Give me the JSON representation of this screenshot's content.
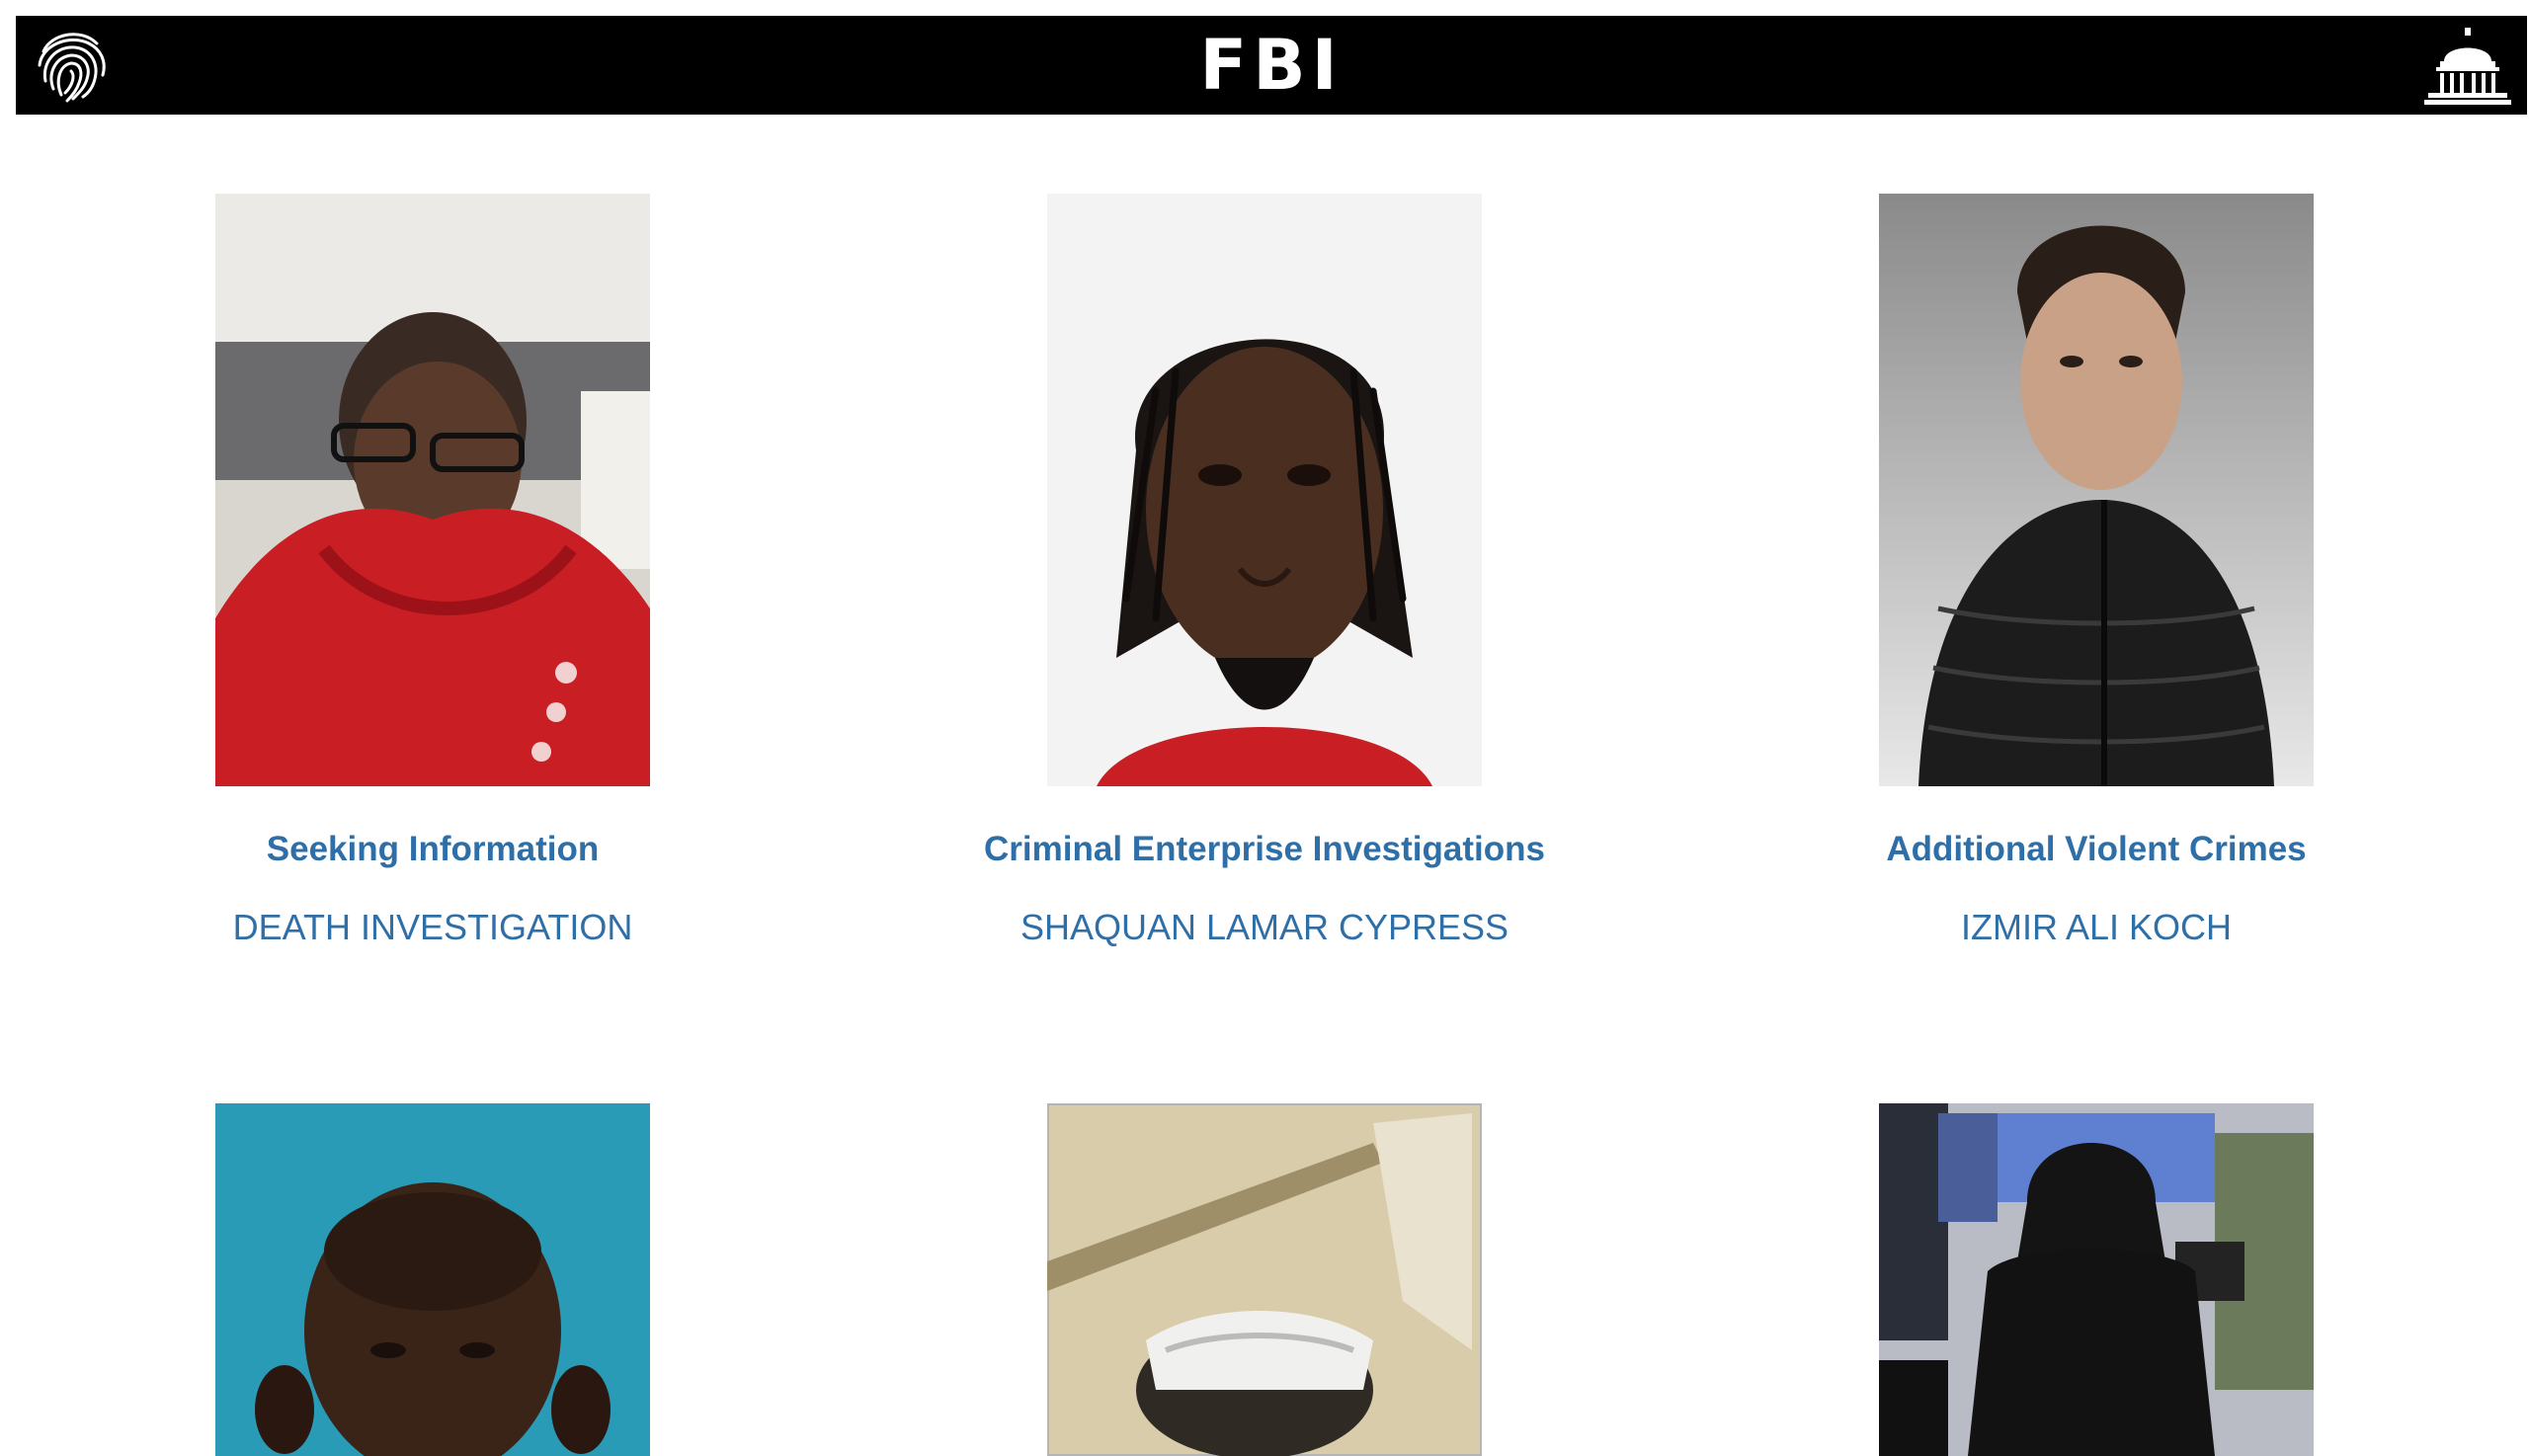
{
  "header": {
    "brand": "FBI",
    "left_icon": "fingerprint-icon",
    "right_icon": "capitol-building-icon"
  },
  "cards": [
    {
      "category": "Seeking Information",
      "name": "DEATH INVESTIGATION",
      "photo": "woman in red sweater with glasses"
    },
    {
      "category": "Criminal Enterprise Investigations",
      "name": "SHAQUAN LAMAR CYPRESS",
      "photo": "man with twisted hair"
    },
    {
      "category": "Additional Violent Crimes",
      "name": "IZMIR ALI KOCH",
      "photo": "man in black puffer jacket"
    },
    {
      "category": "",
      "name": "",
      "photo": "older bald man on blue background"
    },
    {
      "category": "",
      "name": "",
      "photo": "person in white cap, blurry indoor"
    },
    {
      "category": "",
      "name": "",
      "photo": "hooded person in store surveillance"
    }
  ],
  "colors": {
    "link": "#2e6fa8",
    "header_bg": "#000000"
  }
}
